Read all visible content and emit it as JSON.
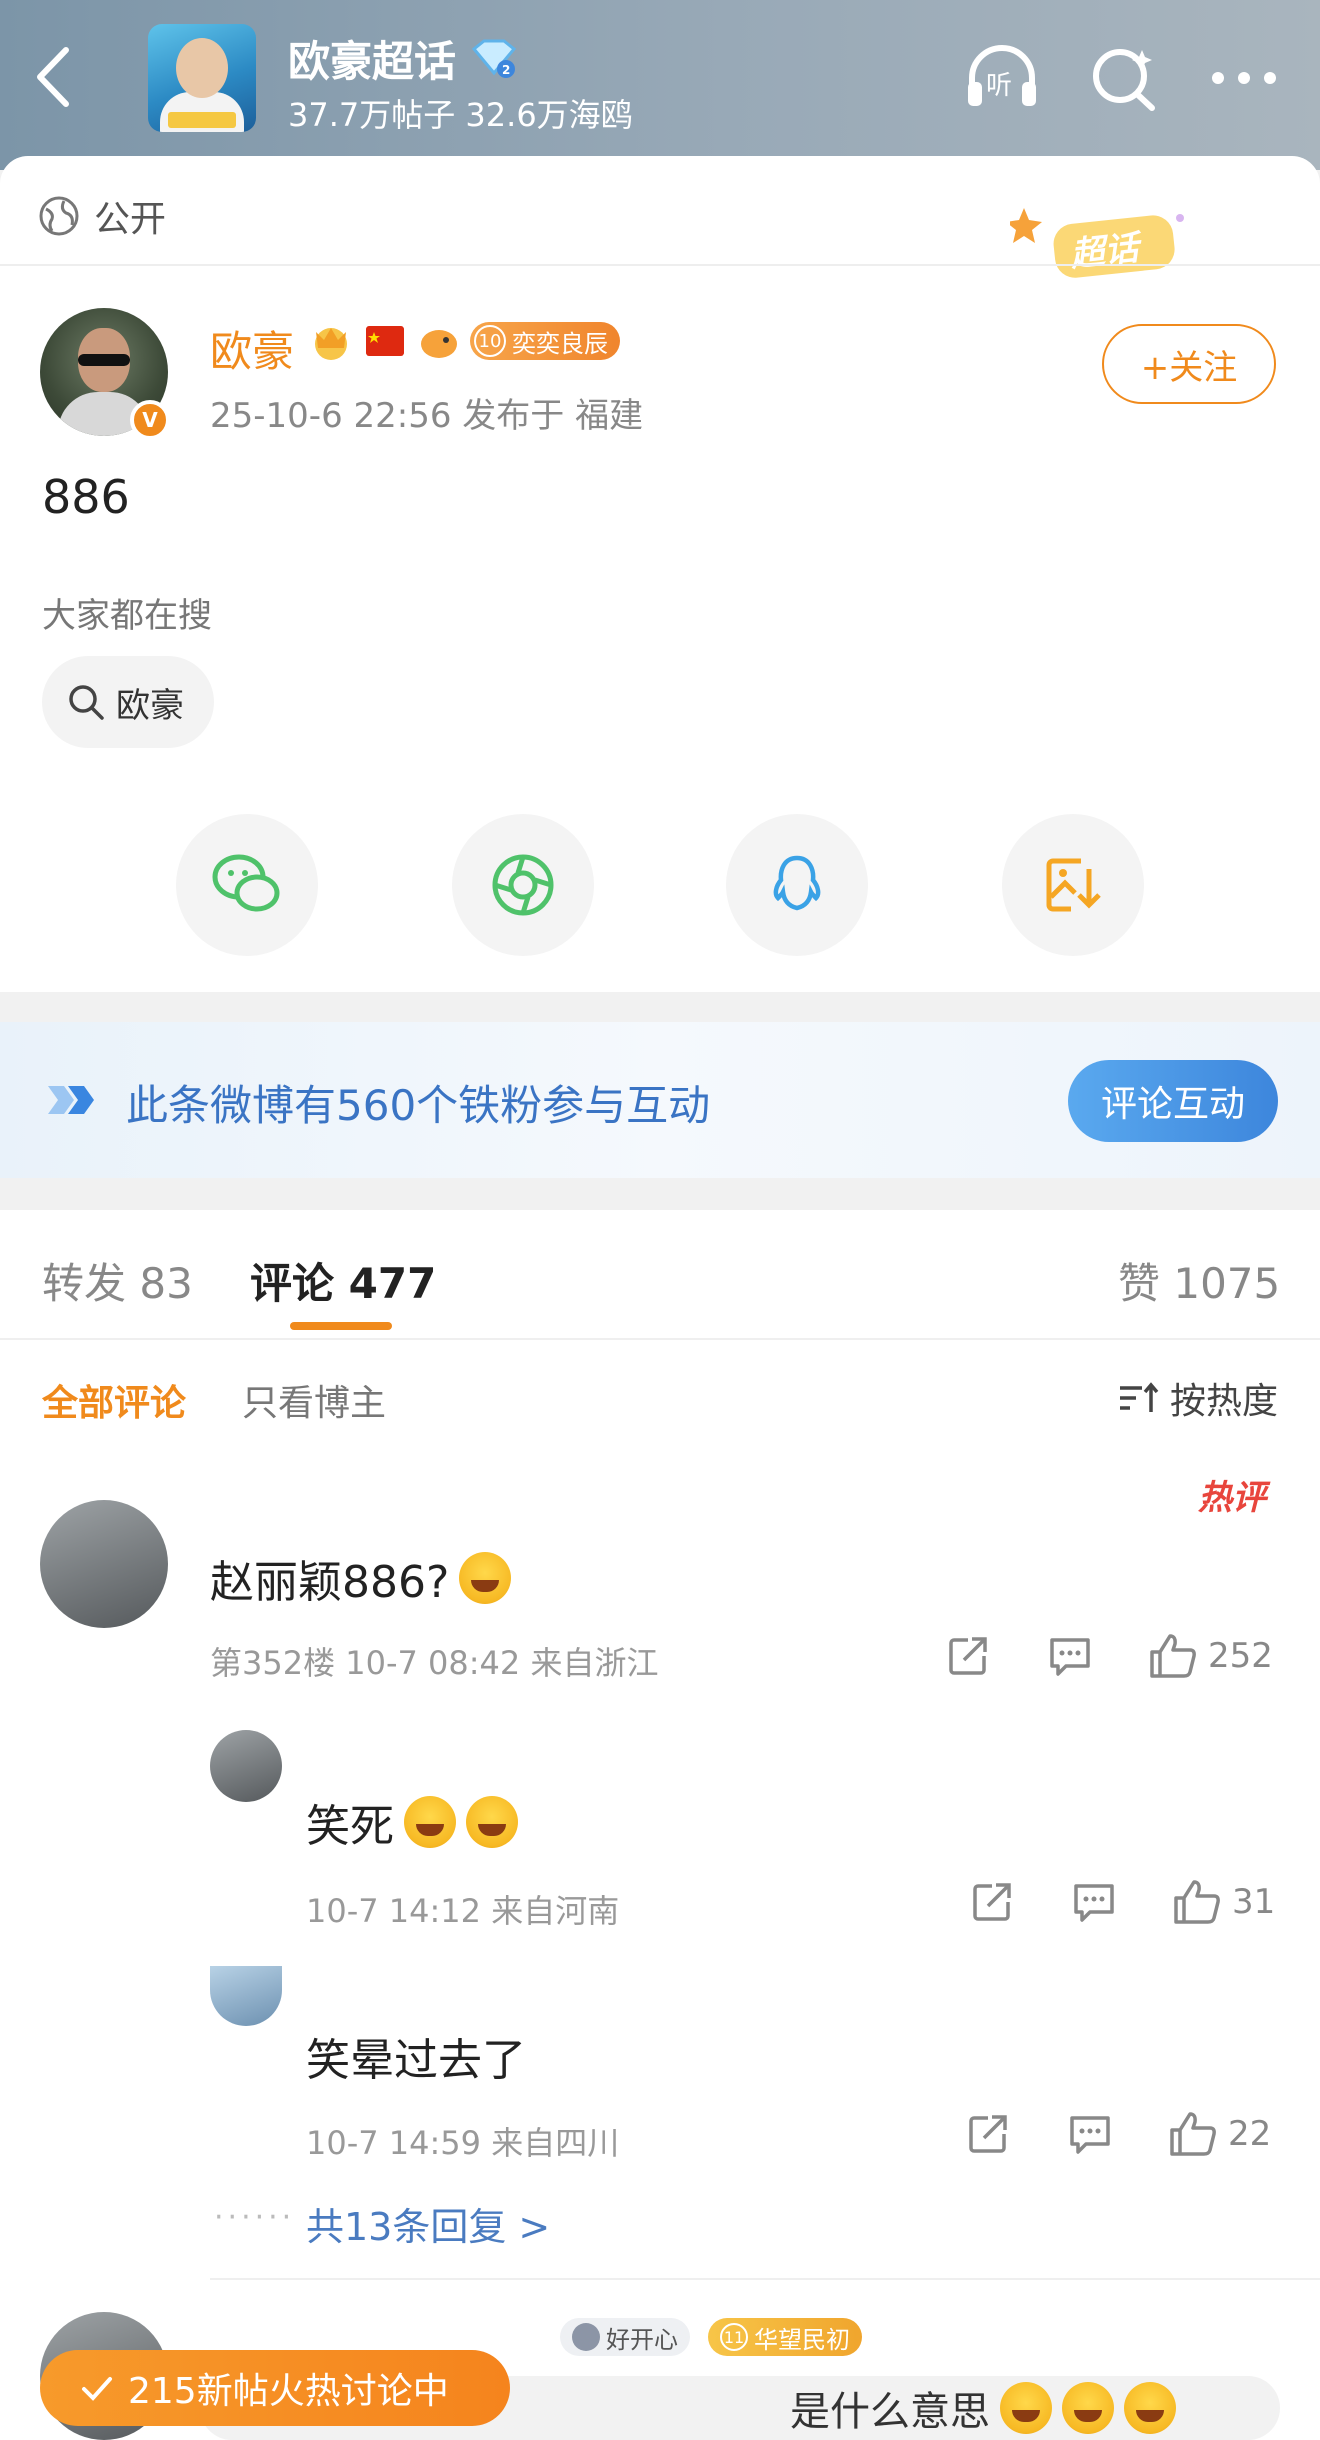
{
  "header": {
    "topic_title": "欧豪超话",
    "topic_stats": "37.7万帖子 32.6万海鸥",
    "colors": {
      "bar_bg": "#8fa3b3",
      "text": "#ffffff"
    }
  },
  "post": {
    "visibility": "公开",
    "chaohua_badge": "超话",
    "author": "欧豪",
    "level_num": "10",
    "level_title": "奕奕良辰",
    "meta": "25-10-6 22:56  发布于 福建",
    "follow_label": "+关注",
    "content": "886",
    "search_label": "大家都在搜",
    "search_chip": "欧豪"
  },
  "share": [
    "wechat-icon",
    "moments-icon",
    "qq-icon",
    "save-image-icon"
  ],
  "ironfan": {
    "text": "此条微博有560个铁粉参与互动",
    "button": "评论互动"
  },
  "tabs": {
    "repost": "转发 83",
    "comment": "评论 477",
    "like": "赞 1075"
  },
  "filters": {
    "all": "全部评论",
    "author_only": "只看博主",
    "sort": "按热度"
  },
  "comments": [
    {
      "hot": "热评",
      "text": "赵丽颖886?",
      "meta": "第352楼 10-7 08:42 来自浙江",
      "likes": "252"
    }
  ],
  "replies": [
    {
      "text": "笑死",
      "meta": "10-7 14:12 来自河南",
      "likes": "31"
    },
    {
      "text": "笑晕过去了",
      "meta": "10-7 14:59 来自四川",
      "likes": "22"
    }
  ],
  "more_replies": "共13条回复 >",
  "next_comment": {
    "badge_mood": "好开心",
    "badge_level_num": "11",
    "badge_level_title": "华望民初",
    "hot_strip": "215新帖火热讨论中",
    "text_tail": "是什么意思"
  },
  "accent_colors": {
    "orange": "#f08a1c",
    "blue": "#3a74c4",
    "red": "#e8453c"
  }
}
